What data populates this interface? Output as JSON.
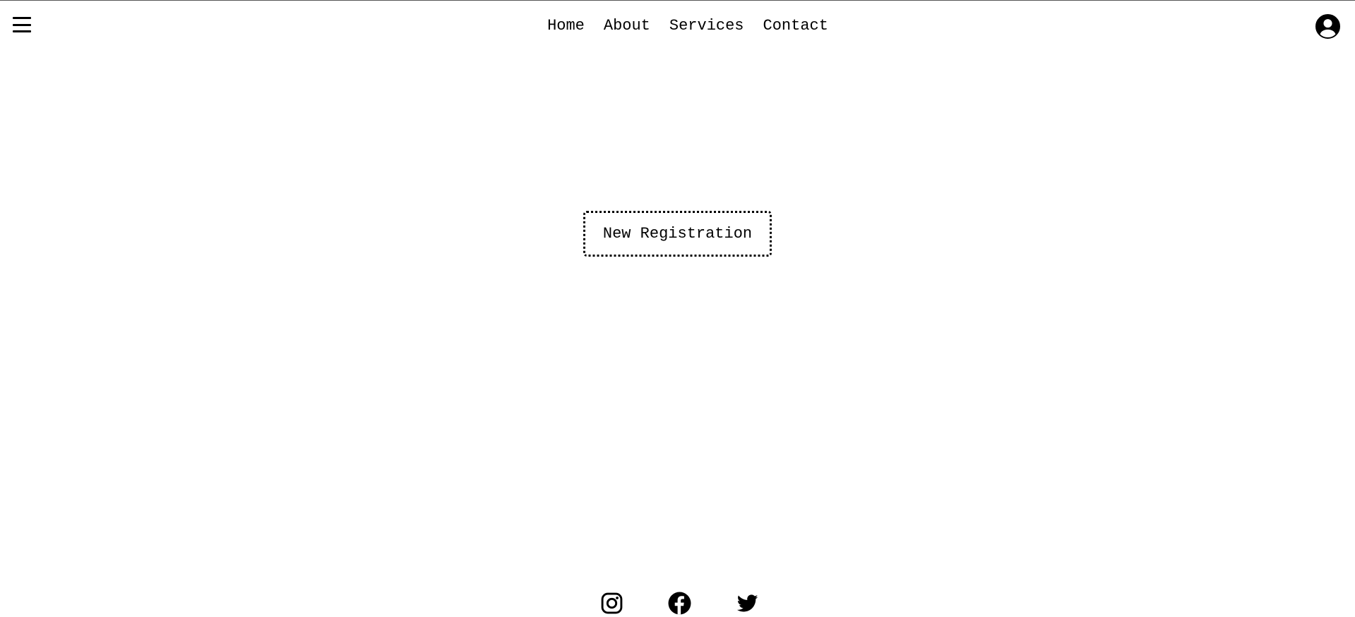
{
  "header": {
    "menu_icon": "hamburger-menu-icon",
    "nav": {
      "items": [
        {
          "label": "Home"
        },
        {
          "label": "About"
        },
        {
          "label": "Services"
        },
        {
          "label": "Contact"
        }
      ]
    },
    "profile_icon": "user-circle-icon"
  },
  "main": {
    "register_button_label": "New Registration"
  },
  "footer": {
    "social_icons": [
      "instagram-icon",
      "facebook-icon",
      "twitter-icon"
    ]
  },
  "colors": {
    "background": "#ffffff",
    "foreground": "#000000"
  }
}
